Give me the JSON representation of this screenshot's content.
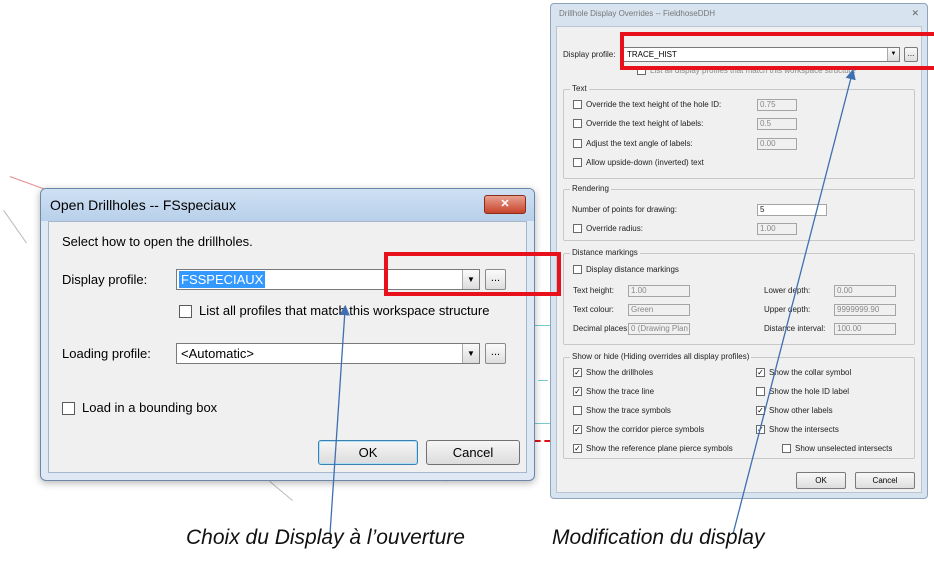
{
  "open_dialog": {
    "title": "Open Drillholes -- FSspeciaux",
    "close_glyph": "✕",
    "instruction": "Select how to open the drillholes.",
    "display_profile_label": "Display profile:",
    "display_profile_value": "FSSPECIAUX",
    "browse_label": "...",
    "list_all_label": "List all profiles that match this workspace structure",
    "loading_profile_label": "Loading profile:",
    "loading_profile_value": "<Automatic>",
    "bounding_box_label": "Load in a bounding box",
    "ok_label": "OK",
    "cancel_label": "Cancel"
  },
  "override_dialog": {
    "title": "Drillhole Display Overrides -- FieldhoseDDH",
    "close_glyph": "✕",
    "display_profile_label": "Display profile:",
    "display_profile_value": "TRACE_HIST",
    "browse_label": "...",
    "list_all_label": "List all display profiles that match this workspace structure",
    "text_group": {
      "caption": "Text",
      "items": [
        {
          "label": "Override the text height of the hole ID:",
          "value": "0.75"
        },
        {
          "label": "Override the text height of labels:",
          "value": "0.5"
        },
        {
          "label": "Adjust the text angle of labels:",
          "value": "0.00"
        },
        {
          "label": "Allow upside-down (inverted) text",
          "value": ""
        }
      ]
    },
    "rendering_group": {
      "caption": "Rendering",
      "points_label": "Number of points for drawing:",
      "points_value": "5",
      "radius_label": "Override radius:",
      "radius_value": "1.00"
    },
    "distance_group": {
      "caption": "Distance markings",
      "display_label": "Display distance markings",
      "text_height_label": "Text height:",
      "text_height_value": "1.00",
      "text_colour_label": "Text colour:",
      "text_colour_value": "Green",
      "decimal_label": "Decimal places:",
      "decimal_value": "0 (Drawing Plan",
      "lower_depth_label": "Lower depth:",
      "lower_depth_value": "0.00",
      "upper_depth_label": "Upper depth:",
      "upper_depth_value": "9999999.90",
      "interval_label": "Distance interval:",
      "interval_value": "100.00"
    },
    "show_group": {
      "caption": "Show or hide (Hiding overrides all display profiles)",
      "left": [
        {
          "label": "Show the drillholes",
          "checked": true
        },
        {
          "label": "Show the trace line",
          "checked": true
        },
        {
          "label": "Show the trace symbols",
          "checked": false
        },
        {
          "label": "Show the corridor pierce symbols",
          "checked": true
        },
        {
          "label": "Show the reference plane pierce symbols",
          "checked": true
        }
      ],
      "right": [
        {
          "label": "Show the collar symbol",
          "checked": true
        },
        {
          "label": "Show the hole ID label",
          "checked": false
        },
        {
          "label": "Show other labels",
          "checked": true
        },
        {
          "label": "Show the intersects",
          "checked": true
        },
        {
          "label": "Show unselected intersects",
          "checked": false
        }
      ]
    },
    "ok_label": "OK",
    "cancel_label": "Cancel"
  },
  "captions": {
    "left": "Choix du Display à l’ouverture",
    "right": "Modification du display"
  },
  "colors": {
    "highlight_box": "#e8101b",
    "arrow": "#3f6fb0",
    "selection": "#3399ff"
  },
  "icons": [
    "close-icon",
    "dropdown-arrow-icon",
    "checkbox-icon",
    "arrow-annotation-icon"
  ]
}
